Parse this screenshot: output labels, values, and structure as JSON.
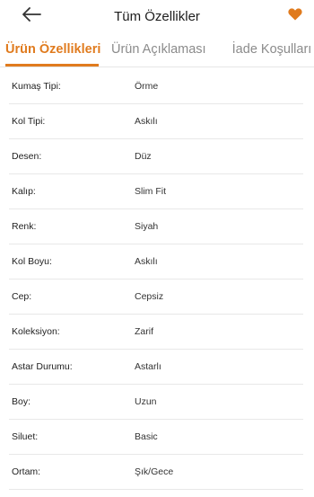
{
  "header": {
    "title": "Tüm Özellikler",
    "back_icon": "arrow-left-icon",
    "favorite_icon": "heart-icon",
    "accent_color": "#e07b1e"
  },
  "tabs": [
    {
      "label": "Ürün Özellikleri",
      "active": true
    },
    {
      "label": "Ürün Açıklaması",
      "active": false
    },
    {
      "label": "İade Koşulları",
      "active": false
    }
  ],
  "attributes": [
    {
      "label": "Kumaş Tipi:",
      "value": "Örme"
    },
    {
      "label": "Kol Tipi:",
      "value": "Askılı"
    },
    {
      "label": "Desen:",
      "value": "Düz"
    },
    {
      "label": "Kalıp:",
      "value": "Slim Fit"
    },
    {
      "label": "Renk:",
      "value": "Siyah"
    },
    {
      "label": "Kol Boyu:",
      "value": "Askılı"
    },
    {
      "label": "Cep:",
      "value": "Cepsiz"
    },
    {
      "label": "Koleksiyon:",
      "value": "Zarif"
    },
    {
      "label": "Astar Durumu:",
      "value": "Astarlı"
    },
    {
      "label": "Boy:",
      "value": "Uzun"
    },
    {
      "label": "Siluet:",
      "value": "Basic"
    },
    {
      "label": "Ortam:",
      "value": "Şık/Gece"
    }
  ]
}
